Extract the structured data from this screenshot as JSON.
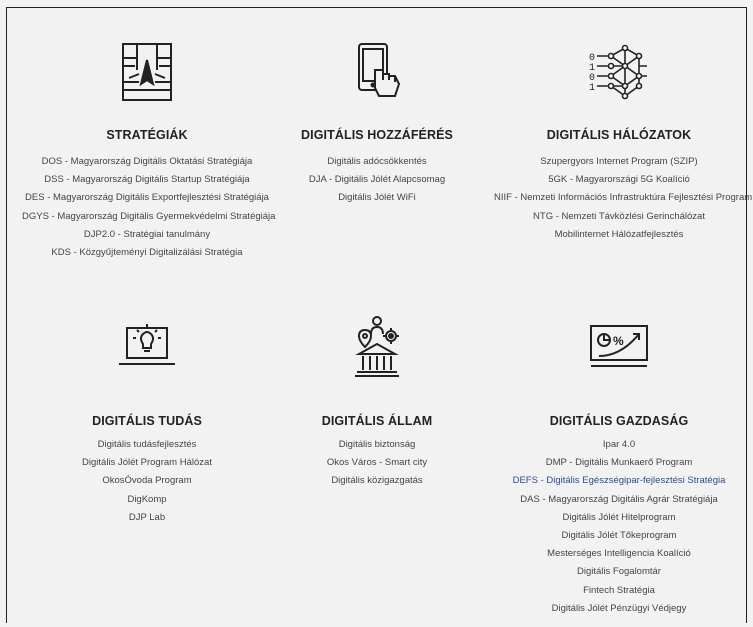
{
  "sections": [
    {
      "title": "STRATÉGIÁK",
      "icon": "strategy-map-icon",
      "items": [
        "DOS - Magyarország Digitális Oktatási Stratégiája",
        "DSS - Magyarország Digitális Startup Stratégiája",
        "DES - Magyarország Digitális Exportfejlesztési Stratégiája",
        "DGYS - Magyarország Digitális Gyermekvédelmi Stratégiája",
        "DJP2.0 - Stratégiai tanulmány",
        "KDS - Közgyűjteményi Digitalizálási Stratégia"
      ]
    },
    {
      "title": "DIGITÁLIS HOZZÁFÉRÉS",
      "icon": "tablet-hand-icon",
      "items": [
        "Digitális adócsökkentés",
        "DJA - Digitális Jólét Alapcsomag",
        "Digitális Jólét WiFi"
      ]
    },
    {
      "title": "DIGITÁLIS HÁLÓZATOK",
      "icon": "binary-network-icon",
      "items": [
        "Szupergyors Internet Program (SZIP)",
        "5GK - Magyarországi 5G Koalíció",
        "NIIF - Nemzeti Információs Infrastruktúra Fejlesztési Program",
        "NTG - Nemzeti Távközlési Gerinchálózat",
        "Mobilinternet Hálózatfejlesztés"
      ]
    },
    {
      "title": "DIGITÁLIS TUDÁS",
      "icon": "laptop-lightbulb-icon",
      "items": [
        "Digitális tudásfejlesztés",
        "Digitális Jólét Program Hálózat",
        "OkosÓvoda Program",
        "DigKomp",
        "DJP Lab"
      ]
    },
    {
      "title": "DIGITÁLIS ÁLLAM",
      "icon": "government-building-icon",
      "items": [
        "Digitális biztonság",
        "Okos Város - Smart city",
        "Digitális közigazgatás"
      ]
    },
    {
      "title": "DIGITÁLIS GAZDASÁG",
      "icon": "growth-chart-icon",
      "items": [
        "Ipar 4.0",
        "DMP - Digitális Munkaerő Program",
        "DEFS - Digitális Egészségipar-fejlesztési Stratégia",
        "DAS - Magyarország Digitális Agrár Stratégiája",
        "Digitális Jólét Hitelprogram",
        "Digitális Jólét Tőkeprogram",
        "Mesterséges Intelligencia Koalíció",
        "Digitális Fogalomtár",
        "Fintech Stratégia",
        "Digitális Jólét Pénzügyi Védjegy"
      ]
    }
  ],
  "icon_glyphs": {
    "binary": [
      "0",
      "1",
      "0",
      "1"
    ],
    "percent": "%"
  },
  "colors": {
    "text": "#444444",
    "title": "#222222",
    "link_highlight": "#2e4b8c",
    "background": "#f2f2f2"
  }
}
